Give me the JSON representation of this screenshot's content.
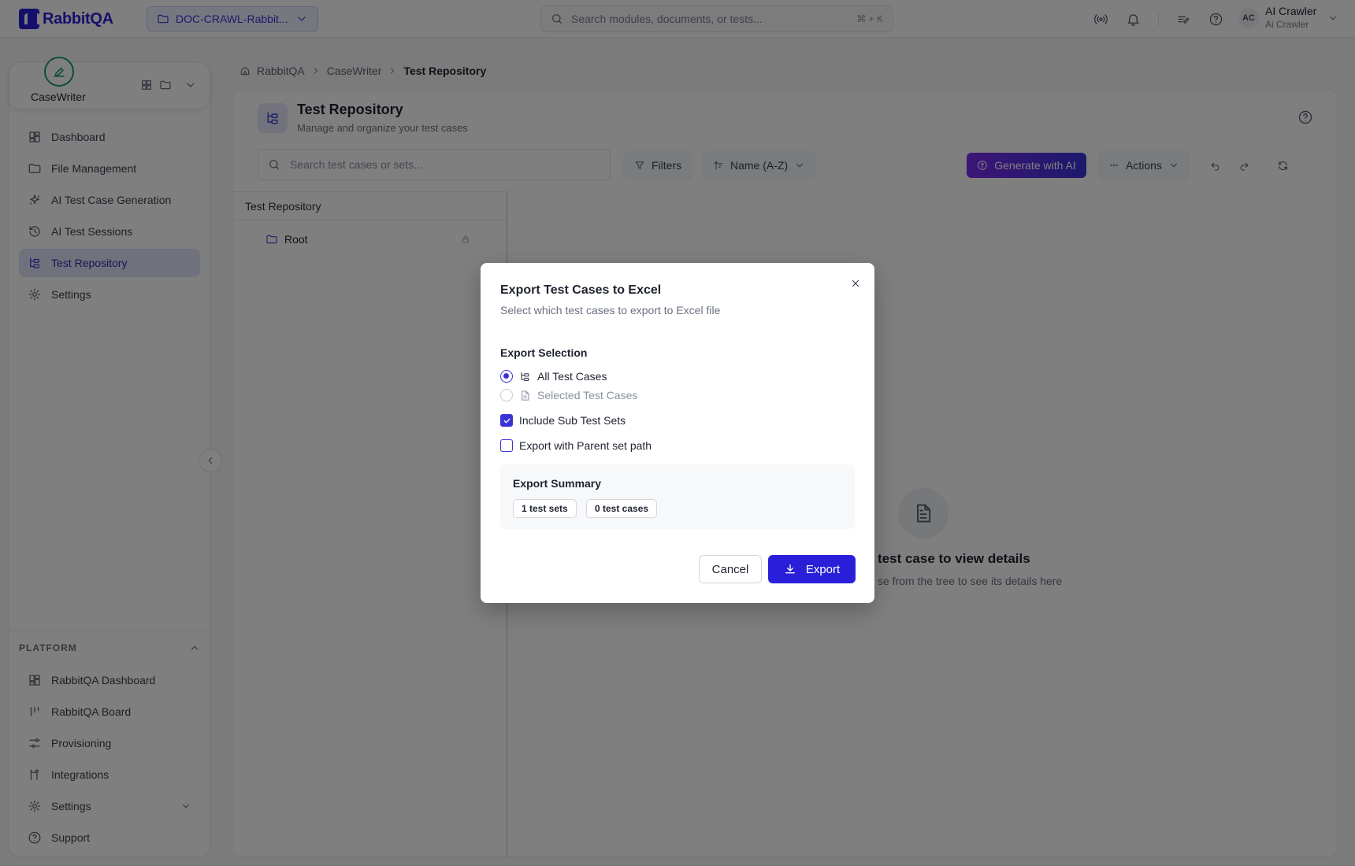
{
  "topbar": {
    "logo_text": "RabbitQA",
    "project_name": "DOC-CRAWL-Rabbit...",
    "search_placeholder": "Search modules, documents, or tests...",
    "search_shortcut": "⌘ + K",
    "user_initials": "AC",
    "user_name": "AI Crawler",
    "user_role": "Ai Crawler"
  },
  "sidebar": {
    "module_name": "CaseWriter",
    "items": [
      {
        "label": "Dashboard",
        "icon": "dashboard-icon"
      },
      {
        "label": "File Management",
        "icon": "folder-icon"
      },
      {
        "label": "AI Test Case Generation",
        "icon": "sparkles-icon"
      },
      {
        "label": "AI Test Sessions",
        "icon": "history-icon"
      },
      {
        "label": "Test Repository",
        "icon": "tree-icon",
        "active": true
      },
      {
        "label": "Settings",
        "icon": "gear-icon"
      }
    ],
    "platform_heading": "PLATFORM",
    "platform_items": [
      {
        "label": "RabbitQA Dashboard",
        "icon": "dashboard-icon"
      },
      {
        "label": "RabbitQA Board",
        "icon": "board-icon"
      },
      {
        "label": "Provisioning",
        "icon": "sliders-icon"
      },
      {
        "label": "Integrations",
        "icon": "integrations-icon"
      },
      {
        "label": "Settings",
        "icon": "gear-icon"
      },
      {
        "label": "Support",
        "icon": "help-icon"
      }
    ]
  },
  "breadcrumb": [
    "RabbitQA",
    "CaseWriter",
    "Test Repository"
  ],
  "page": {
    "title": "Test Repository",
    "subtitle": "Manage and organize your test cases",
    "search_placeholder": "Search test cases or sets...",
    "filters_label": "Filters",
    "sort_label": "Name (A-Z)",
    "generate_label": "Generate with AI",
    "actions_label": "Actions"
  },
  "tree": {
    "header": "Test Repository",
    "root_label": "Root"
  },
  "empty_state": {
    "title": "test case to view details",
    "subtitle": "se from the tree to see its details here"
  },
  "modal": {
    "title": "Export Test Cases to Excel",
    "subtitle": "Select which test cases to export to Excel file",
    "selection_label": "Export Selection",
    "option_all": "All Test Cases",
    "option_selected": "Selected Test Cases",
    "include_sub_label": "Include Sub Test Sets",
    "include_sub_checked": true,
    "parent_path_label": "Export with Parent set path",
    "parent_path_checked": false,
    "summary_title": "Export Summary",
    "summary_sets": "1 test sets",
    "summary_cases": "0 test cases",
    "cancel_label": "Cancel",
    "export_label": "Export"
  },
  "colors": {
    "brand": "#2a1fd9",
    "active_nav_bg": "#dfe3fb",
    "module_accent": "#1f9d66"
  }
}
